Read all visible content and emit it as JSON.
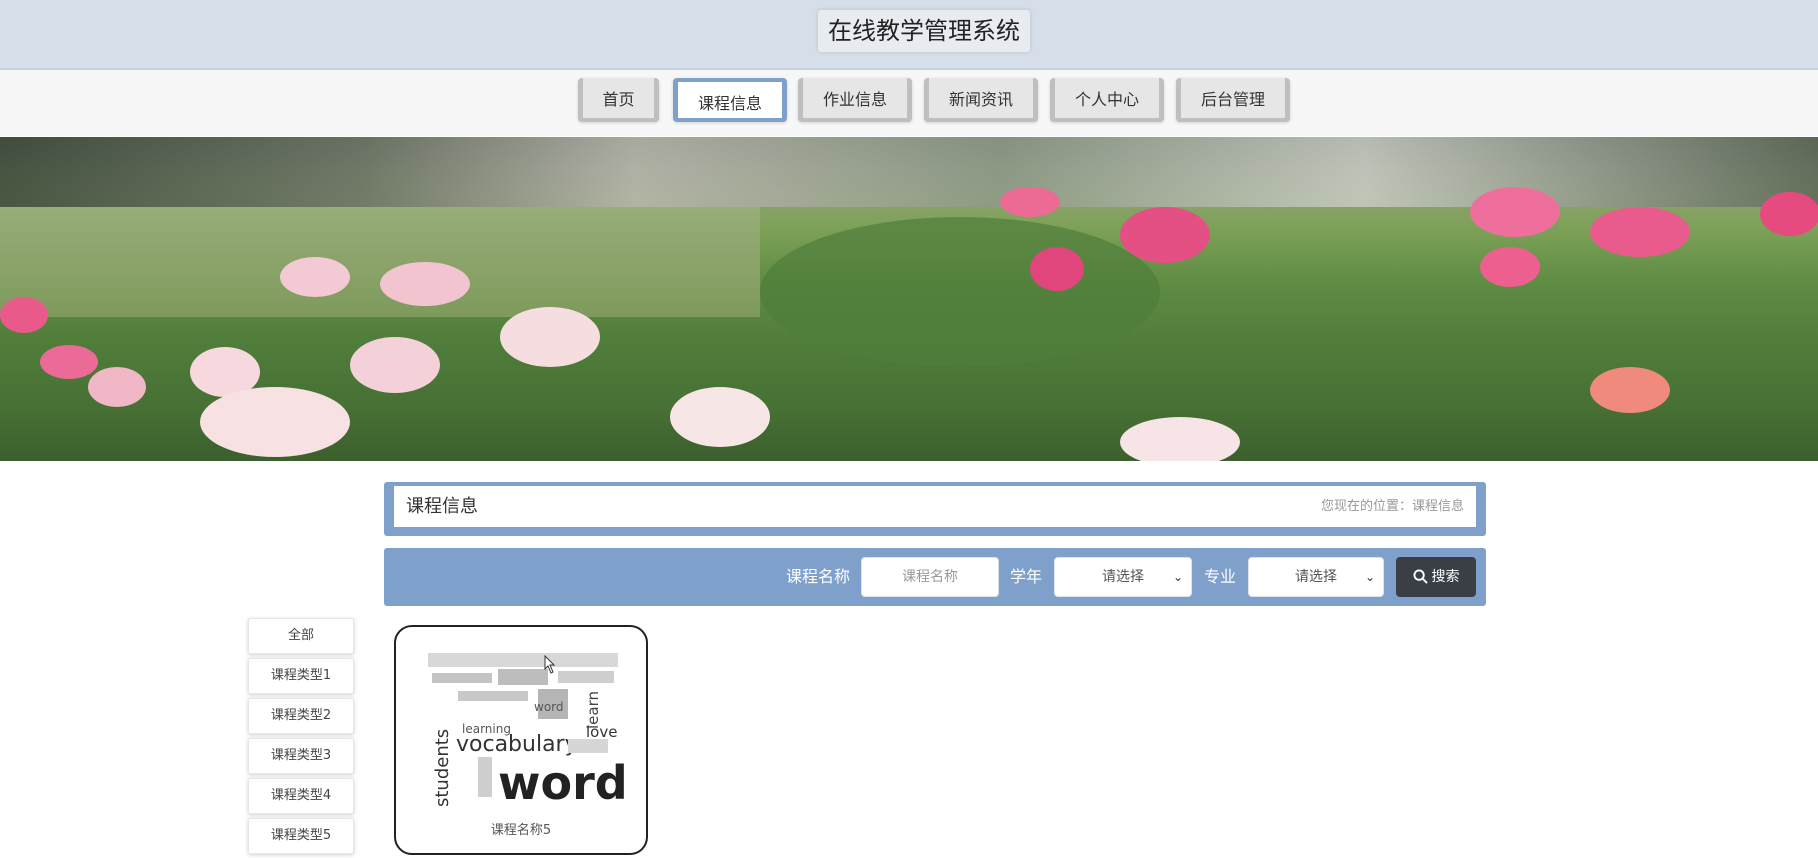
{
  "site": {
    "title": "在线教学管理系统"
  },
  "nav": {
    "items": [
      {
        "label": "首页"
      },
      {
        "label": "课程信息",
        "active": true
      },
      {
        "label": "作业信息"
      },
      {
        "label": "新闻资讯"
      },
      {
        "label": "个人中心"
      },
      {
        "label": "后台管理"
      }
    ]
  },
  "banner": {
    "slides": 3,
    "active_slide": 2
  },
  "section": {
    "title": "课程信息",
    "breadcrumb": "您现在的位置：课程信息"
  },
  "search": {
    "name_label": "课程名称",
    "name_placeholder": "课程名称",
    "year_label": "学年",
    "year_value": "请选择",
    "major_label": "专业",
    "major_value": "请选择",
    "button_label": "搜索"
  },
  "categories": [
    "全部",
    "课程类型1",
    "课程类型2",
    "课程类型3",
    "课程类型4",
    "课程类型5"
  ],
  "courses": [
    {
      "name": "课程名称5",
      "image_words": [
        "vocabulary",
        "words",
        "students",
        "learn",
        "love",
        "word",
        "learning"
      ]
    }
  ],
  "colors": {
    "accent": "#7fa0cb",
    "header_bg": "#d6dfe9",
    "search_button": "#3a3f46"
  }
}
